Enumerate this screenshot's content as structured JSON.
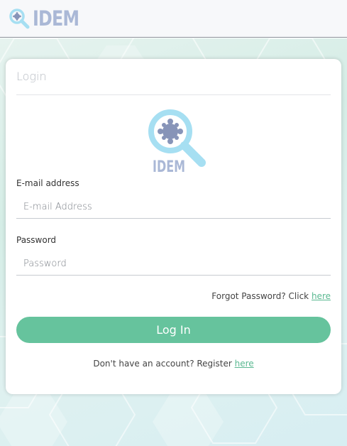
{
  "header": {
    "brand": "IDEM"
  },
  "login_card": {
    "title": "Login",
    "logo_text": "IDEM",
    "email": {
      "label": "E-mail address",
      "placeholder": "E-mail Address",
      "value": ""
    },
    "password": {
      "label": "Password",
      "placeholder": "Password",
      "value": ""
    },
    "forgot": {
      "text": "Forgot Password? Click ",
      "link": "here"
    },
    "login_button": "Log In",
    "register": {
      "text": "Don't have an account? Register ",
      "link": "here"
    }
  },
  "colors": {
    "brand": "#aab8d6",
    "accent_green": "#66c39d",
    "logo_blue": "#a6dff2"
  }
}
